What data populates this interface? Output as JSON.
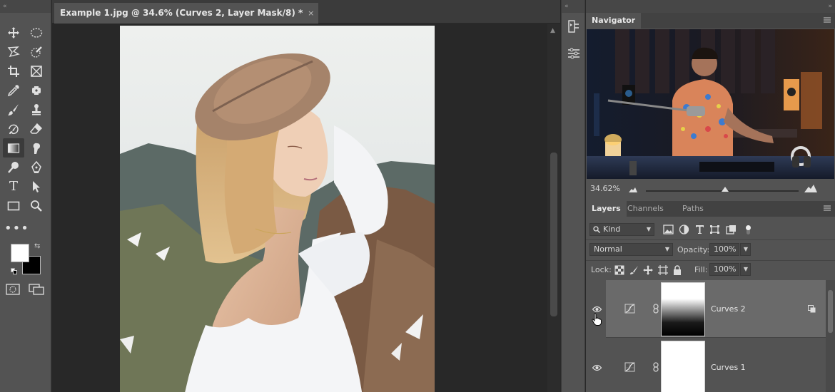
{
  "document": {
    "tab_title": "Example 1.jpg @ 34.6% (Curves 2, Layer Mask/8) *",
    "close_glyph": "×"
  },
  "toolbar": {
    "collapse_glyph": "«",
    "tools": [
      {
        "name": "move-tool",
        "icon": "move-icon"
      },
      {
        "name": "marquee-tool",
        "icon": "elliptical-marquee-icon"
      },
      {
        "name": "lasso-tool",
        "icon": "polygonal-lasso-icon"
      },
      {
        "name": "quick-selection-tool",
        "icon": "quick-selection-icon"
      },
      {
        "name": "crop-tool",
        "icon": "crop-icon"
      },
      {
        "name": "frame-tool",
        "icon": "frame-icon"
      },
      {
        "name": "eyedropper-tool",
        "icon": "eyedropper-icon"
      },
      {
        "name": "healing-tool",
        "icon": "spot-healing-icon"
      },
      {
        "name": "brush-tool",
        "icon": "brush-icon"
      },
      {
        "name": "clone-stamp-tool",
        "icon": "stamp-icon"
      },
      {
        "name": "history-brush-tool",
        "icon": "history-brush-icon"
      },
      {
        "name": "eraser-tool",
        "icon": "eraser-icon"
      },
      {
        "name": "gradient-tool",
        "icon": "gradient-icon",
        "active": true
      },
      {
        "name": "smudge-tool",
        "icon": "smudge-icon"
      },
      {
        "name": "dodge-tool",
        "icon": "dodge-icon"
      },
      {
        "name": "pen-tool",
        "icon": "pen-icon"
      },
      {
        "name": "type-tool",
        "icon": "type-icon",
        "label": "T"
      },
      {
        "name": "path-selection-tool",
        "icon": "arrow-icon"
      },
      {
        "name": "rectangle-tool",
        "icon": "rectangle-icon"
      },
      {
        "name": "zoom-tool",
        "icon": "magnifier-icon"
      }
    ],
    "more_glyph": "•••",
    "swap_glyph": "⇆",
    "colors": {
      "foreground": "#ffffff",
      "background": "#000000"
    }
  },
  "navigator": {
    "tab_label": "Navigator",
    "zoom": "34.62%",
    "zoom_slider_fraction": 0.52
  },
  "layers_panel": {
    "tabs": [
      "Layers",
      "Channels",
      "Paths"
    ],
    "active_tab": "Layers",
    "filter_kind": "Kind",
    "blend_mode": "Normal",
    "opacity_label": "Opacity:",
    "opacity_value": "100%",
    "lock_label": "Lock:",
    "fill_label": "Fill:",
    "fill_value": "100%",
    "layers": [
      {
        "name": "Curves 2",
        "selected": true,
        "visible": true,
        "mask": "white-to-black-gradient"
      },
      {
        "name": "Curves 1",
        "selected": false,
        "visible": true,
        "mask": "white"
      }
    ]
  },
  "grip_glyph": "«",
  "grip_glyph_right": "»",
  "colors": {
    "panel_bg": "#535353",
    "app_bg": "#282828",
    "selected_layer": "#6a6a6a"
  }
}
